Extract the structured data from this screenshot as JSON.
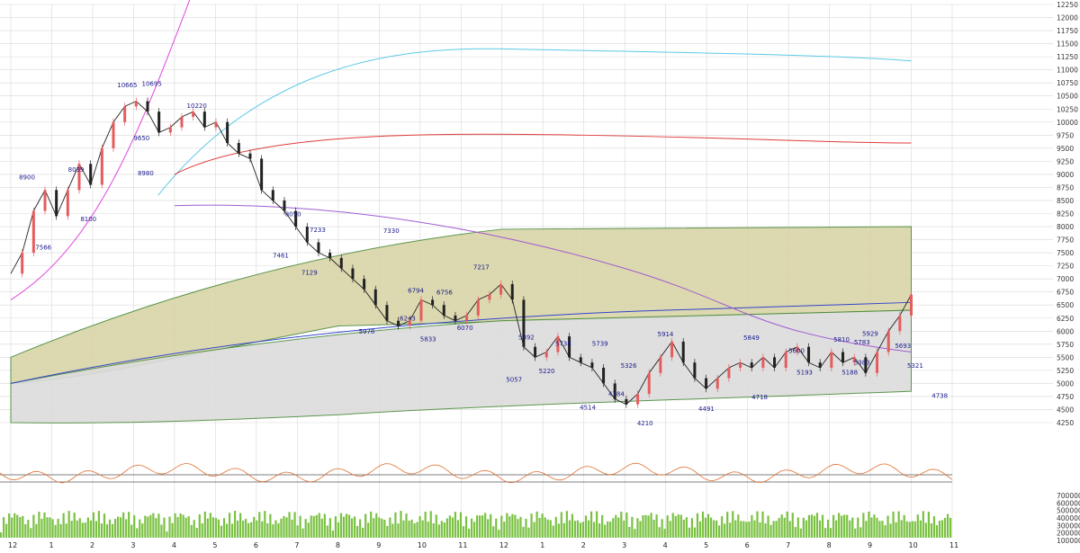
{
  "chart_data": {
    "type": "line",
    "title": "",
    "price_axis": {
      "min": 4250,
      "max": 12250,
      "step": 250,
      "ticks": [
        "12250",
        "12000",
        "11750",
        "11500",
        "11250",
        "11000",
        "10750",
        "10500",
        "10250",
        "10000",
        "9750",
        "9500",
        "9250",
        "9000",
        "8750",
        "8500",
        "8250",
        "8000",
        "7750",
        "7500",
        "7250",
        "7000",
        "6750",
        "6500",
        "6250",
        "6000",
        "5750",
        "5500",
        "5250",
        "5000",
        "4750",
        "4500",
        "4250"
      ]
    },
    "volume_axis": {
      "ticks": [
        "700000",
        "600000",
        "500000",
        "400000",
        "300000",
        "200000",
        "100000"
      ],
      "min": 0,
      "max": 700000
    },
    "month_labels": [
      "12",
      "1",
      "2",
      "3",
      "4",
      "5",
      "6",
      "7",
      "8",
      "9",
      "10",
      "11",
      "12",
      "1",
      "2",
      "3",
      "4",
      "5",
      "6",
      "7",
      "8",
      "9",
      "10",
      "11"
    ],
    "annotations": [
      {
        "text": "8900",
        "month_index": 0.2,
        "value": 8900
      },
      {
        "text": "8039",
        "month_index": 1.4,
        "value": 9050
      },
      {
        "text": "10665",
        "month_index": 2.6,
        "value": 10665
      },
      {
        "text": "10695",
        "month_index": 3.2,
        "value": 10695
      },
      {
        "text": "9650",
        "month_index": 3.0,
        "value": 9650
      },
      {
        "text": "8980",
        "month_index": 3.1,
        "value": 8980
      },
      {
        "text": "10220",
        "month_index": 4.3,
        "value": 10270
      },
      {
        "text": "8100",
        "month_index": 1.7,
        "value": 8100
      },
      {
        "text": "7566",
        "month_index": 0.6,
        "value": 7566
      },
      {
        "text": "8050",
        "month_index": 6.7,
        "value": 8200
      },
      {
        "text": "7233",
        "month_index": 7.3,
        "value": 7900
      },
      {
        "text": "7461",
        "month_index": 6.4,
        "value": 7410
      },
      {
        "text": "7129",
        "month_index": 7.1,
        "value": 7080
      },
      {
        "text": "7330",
        "month_index": 9.1,
        "value": 7880
      },
      {
        "text": "6794",
        "month_index": 9.7,
        "value": 6740
      },
      {
        "text": "6756",
        "month_index": 10.4,
        "value": 6700
      },
      {
        "text": "7217",
        "month_index": 11.3,
        "value": 7180
      },
      {
        "text": "6243",
        "month_index": 9.5,
        "value": 6200
      },
      {
        "text": "6070",
        "month_index": 10.9,
        "value": 6020
      },
      {
        "text": "5978",
        "month_index": 8.5,
        "value": 5950
      },
      {
        "text": "5833",
        "month_index": 10.0,
        "value": 5810
      },
      {
        "text": "5892",
        "month_index": 12.4,
        "value": 5840
      },
      {
        "text": "5738",
        "month_index": 13.3,
        "value": 5720
      },
      {
        "text": "5739",
        "month_index": 14.2,
        "value": 5720
      },
      {
        "text": "5057",
        "month_index": 12.1,
        "value": 5030
      },
      {
        "text": "5220",
        "month_index": 12.9,
        "value": 5200
      },
      {
        "text": "5326",
        "month_index": 14.9,
        "value": 5300
      },
      {
        "text": "4784",
        "month_index": 14.6,
        "value": 4760
      },
      {
        "text": "4514",
        "month_index": 13.9,
        "value": 4500
      },
      {
        "text": "4210",
        "month_index": 15.3,
        "value": 4200
      },
      {
        "text": "5914",
        "month_index": 15.8,
        "value": 5900
      },
      {
        "text": "4491",
        "month_index": 16.8,
        "value": 4470
      },
      {
        "text": "5849",
        "month_index": 17.9,
        "value": 5830
      },
      {
        "text": "4718",
        "month_index": 18.1,
        "value": 4700
      },
      {
        "text": "5600",
        "month_index": 19.0,
        "value": 5580
      },
      {
        "text": "5193",
        "month_index": 19.2,
        "value": 5170
      },
      {
        "text": "5810",
        "month_index": 20.1,
        "value": 5800
      },
      {
        "text": "5783",
        "month_index": 20.6,
        "value": 5750
      },
      {
        "text": "5929",
        "month_index": 20.8,
        "value": 5910
      },
      {
        "text": "5383",
        "month_index": 20.6,
        "value": 5360
      },
      {
        "text": "5188",
        "month_index": 20.3,
        "value": 5170
      },
      {
        "text": "5693",
        "month_index": 21.6,
        "value": 5680
      },
      {
        "text": "5321",
        "month_index": 21.9,
        "value": 5300
      },
      {
        "text": "4738",
        "month_index": 22.5,
        "value": 4720
      }
    ],
    "series": [
      {
        "name": "",
        "color": "#222222",
        "role": "close",
        "values": [
          7100,
          7500,
          8300,
          8700,
          8200,
          8700,
          9200,
          8800,
          9500,
          10000,
          10300,
          10400,
          10200,
          9800,
          9900,
          10100,
          10200,
          9900,
          10000,
          9600,
          9400,
          9300,
          8700,
          8500,
          8300,
          8000,
          7700,
          7500,
          7400,
          7200,
          7000,
          6800,
          6500,
          6200,
          6100,
          6200,
          6600,
          6500,
          6300,
          6200,
          6300,
          6600,
          6700,
          6900,
          6600,
          5700,
          5500,
          5600,
          5900,
          5500,
          5400,
          5300,
          5000,
          4700,
          4600,
          4800,
          5200,
          5500,
          5800,
          5400,
          5100,
          4900,
          5100,
          5300,
          5400,
          5300,
          5500,
          5300,
          5600,
          5700,
          5400,
          5300,
          5600,
          5400,
          5500,
          5200,
          5600,
          6000,
          6300,
          6700
        ]
      }
    ],
    "grid": true,
    "legend": "none"
  },
  "colors": {
    "close_line": "#222222",
    "ma_red": "#e03a3a",
    "ma_cyan": "#5cc9e8",
    "ma_purple": "#a05cd0",
    "ma_blue": "#3344cc",
    "ma_magenta": "#e045e0",
    "cloud_olive": "#d9d4a8",
    "cloud_gray": "#dcdcdc",
    "volume_bar": "#7ac142",
    "candle_up": "#e65c5c",
    "candle_down": "#222222",
    "grid": "#d8d8d8"
  }
}
